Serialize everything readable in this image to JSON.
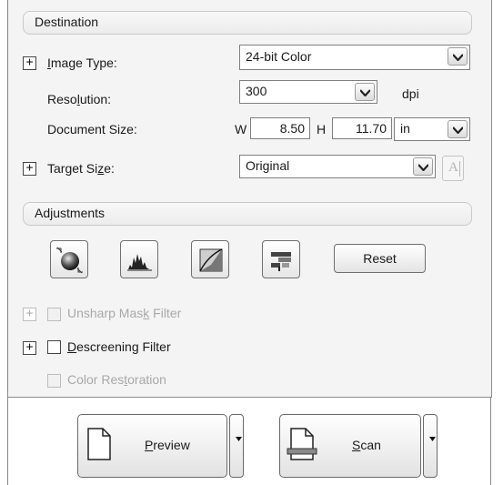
{
  "destination": {
    "section_title": "Destination",
    "image_type": {
      "label_pre": "",
      "label_u": "I",
      "label_post": "mage Type:",
      "value": "24-bit Color"
    },
    "resolution": {
      "label_pre": "Reso",
      "label_u": "l",
      "label_post": "ution:",
      "value": "300",
      "unit": "dpi"
    },
    "document_size": {
      "label": "Document Size:",
      "w_label": "W",
      "w_value": "8.50",
      "h_label": "H",
      "h_value": "11.70",
      "unit": "in"
    },
    "target_size": {
      "label_pre": "Target Si",
      "label_u": "z",
      "label_post": "e:",
      "value": "Original",
      "icon_glyph": "A"
    }
  },
  "adjustments": {
    "section_title": "Adjustments",
    "tools": [
      "image-adjustment-icon",
      "histogram-icon",
      "tone-curve-icon",
      "color-palette-icon"
    ],
    "reset_label": "Reset",
    "unsharp": {
      "label_pre": "Unsharp Mas",
      "label_u": "k",
      "label_post": " Filter",
      "checked": false,
      "enabled": false
    },
    "descreening": {
      "label_pre": "",
      "label_u": "D",
      "label_post": "escreening Filter",
      "checked": false,
      "enabled": true
    },
    "color_restoration": {
      "label_pre": "Color Res",
      "label_u": "t",
      "label_post": "oration",
      "checked": false,
      "enabled": false
    }
  },
  "actions": {
    "preview": {
      "label_pre": "",
      "label_u": "P",
      "label_post": "review"
    },
    "scan": {
      "label_pre": "",
      "label_u": "S",
      "label_post": "can"
    }
  }
}
